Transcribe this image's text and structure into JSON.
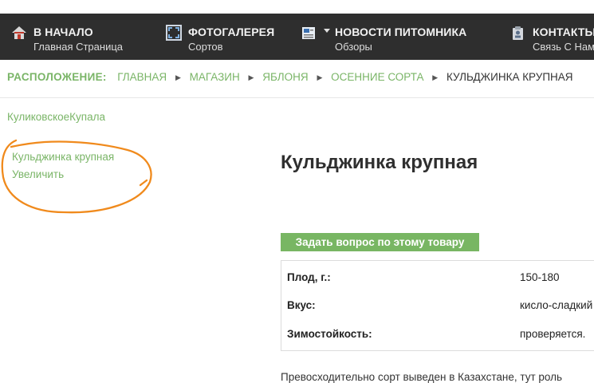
{
  "colors": {
    "nav_bg": "#2e2e2e",
    "accent_green": "#7ab567",
    "button_green": "#78b663",
    "annotation_orange": "#f08a1c"
  },
  "nav": {
    "items": [
      {
        "icon": "home-icon",
        "title": "В НАЧАЛО",
        "subtitle": "Главная Страница"
      },
      {
        "icon": "gallery-icon",
        "title": "ФОТОГАЛЕРЕЯ",
        "subtitle": "Сортов"
      },
      {
        "icon": "news-icon",
        "title": "НОВОСТИ ПИТОМНИКА",
        "subtitle": "Обзоры"
      },
      {
        "icon": "contacts-icon",
        "title": "КОНТАКТЫ",
        "subtitle": "Связь С Нами"
      }
    ]
  },
  "breadcrumb": {
    "label": "РАСПОЛОЖЕНИЕ:",
    "links": [
      "ГЛАВНАЯ",
      "МАГАЗИН",
      "ЯБЛОНЯ",
      "ОСЕННИЕ СОРТА"
    ],
    "current": "КУЛЬДЖИНКА КРУПНАЯ"
  },
  "left": {
    "top_link": "КуликовскоеКупала",
    "image_alt": "Кульджинка крупная",
    "zoom_link": "Увеличить"
  },
  "product": {
    "title": "Кульджинка крупная",
    "ask_button": "Задать вопрос по этому товару",
    "specs": [
      {
        "name": "Плод, г.:",
        "value": "150-180"
      },
      {
        "name": "Вкус:",
        "value": "кисло-сладкий"
      },
      {
        "name": "Зимостойкость:",
        "value": "проверяется."
      }
    ],
    "description": "Превосходительно сорт выведен в Казахстане, тут роль"
  }
}
